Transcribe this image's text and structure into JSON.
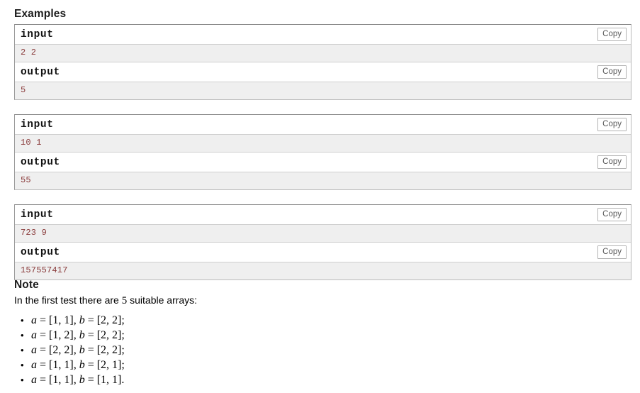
{
  "examples": {
    "heading": "Examples",
    "copy_label": "Copy",
    "input_label": "input",
    "output_label": "output",
    "tests": [
      {
        "input": "2 2",
        "output": "5"
      },
      {
        "input": "10 1",
        "output": "55"
      },
      {
        "input": "723 9",
        "output": "157557417"
      }
    ]
  },
  "note": {
    "heading": "Note",
    "intro_before": "In the first test there are ",
    "intro_count": "5",
    "intro_after": " suitable arrays:",
    "items": [
      {
        "a_var": "a",
        "eq1": " = ",
        "a_val": "[1, 1]",
        "sep": ", ",
        "b_var": "b",
        "eq2": " = ",
        "b_val": "[2, 2]",
        "end": ";"
      },
      {
        "a_var": "a",
        "eq1": " = ",
        "a_val": "[1, 2]",
        "sep": ", ",
        "b_var": "b",
        "eq2": " = ",
        "b_val": "[2, 2]",
        "end": ";"
      },
      {
        "a_var": "a",
        "eq1": " = ",
        "a_val": "[2, 2]",
        "sep": ", ",
        "b_var": "b",
        "eq2": " = ",
        "b_val": "[2, 2]",
        "end": ";"
      },
      {
        "a_var": "a",
        "eq1": " = ",
        "a_val": "[1, 1]",
        "sep": ", ",
        "b_var": "b",
        "eq2": " = ",
        "b_val": "[2, 1]",
        "end": ";"
      },
      {
        "a_var": "a",
        "eq1": " = ",
        "a_val": "[1, 1]",
        "sep": ", ",
        "b_var": "b",
        "eq2": " = ",
        "b_val": "[1, 1]",
        "end": "."
      }
    ]
  },
  "colors": {
    "sample_data_text": "#8a3b3b",
    "sample_data_bg": "#efefef",
    "border": "#bbbbbb"
  }
}
